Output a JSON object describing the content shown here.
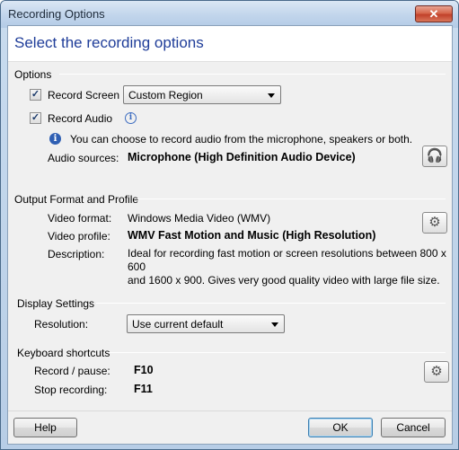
{
  "window": {
    "title": "Recording Options",
    "close_glyph": "✕"
  },
  "header": {
    "title": "Select the recording options"
  },
  "options": {
    "group_label": "Options",
    "record_screen": {
      "label": "Record Screen",
      "checked": true,
      "select_value": "Custom Region"
    },
    "record_audio": {
      "label": "Record Audio",
      "checked": true
    },
    "info_text": "You can choose to record audio from the microphone, speakers or both.",
    "audio_sources": {
      "label": "Audio sources:",
      "value": "Microphone (High Definition Audio Device)"
    }
  },
  "output": {
    "group_label": "Output Format and Profile",
    "video_format": {
      "label": "Video format:",
      "value": "Windows Media Video (WMV)"
    },
    "video_profile": {
      "label": "Video profile:",
      "value": "WMV Fast Motion and Music (High Resolution)"
    },
    "description": {
      "label": "Description:",
      "line1": "Ideal for recording fast motion or screen resolutions between 800 x 600",
      "line2": "and 1600 x 900.  Gives very good quality video with large file size."
    }
  },
  "display": {
    "group_label": "Display Settings",
    "resolution": {
      "label": "Resolution:",
      "value": "Use current default"
    }
  },
  "shortcuts": {
    "group_label": "Keyboard shortcuts",
    "record_pause": {
      "label": "Record / pause:",
      "key": "F10"
    },
    "stop_recording": {
      "label": "Stop recording:",
      "key": "F11"
    }
  },
  "footer": {
    "help": "Help",
    "ok": "OK",
    "cancel": "Cancel"
  },
  "icons": {
    "checkmark": "✓",
    "info": "i",
    "headset": "🎧",
    "settings": "⚙"
  },
  "colors": {
    "title_blue": "#1f3d99",
    "info_blue": "#2f5fb3",
    "close_red": "#c2402a"
  }
}
